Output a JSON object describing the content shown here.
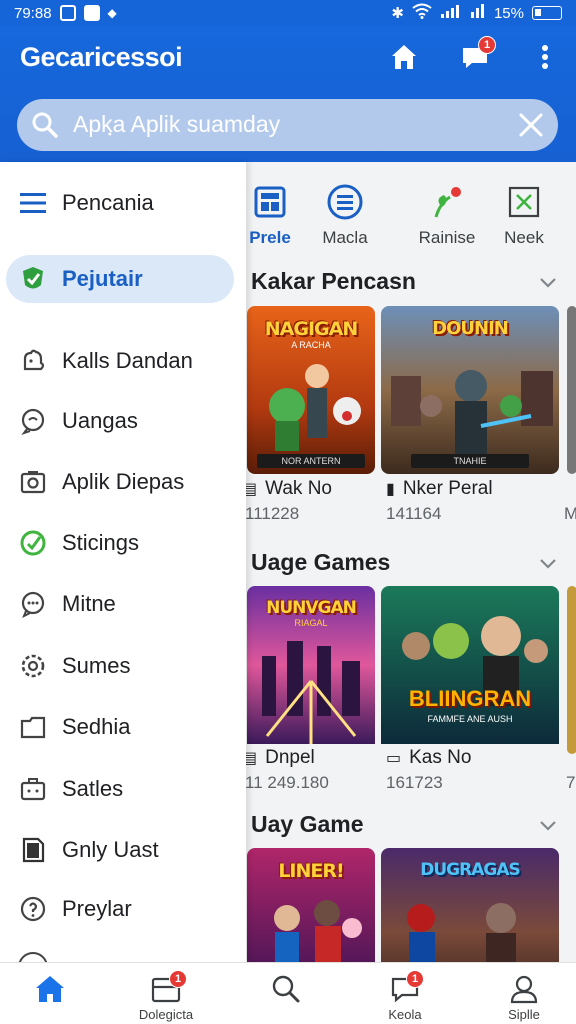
{
  "status_bar": {
    "time": "79:88",
    "battery": "15%"
  },
  "app": {
    "title": "Gecaricessoi",
    "notification_count": "1"
  },
  "search": {
    "text": "Apkฺa Aplik suamday"
  },
  "drawer": {
    "items": [
      {
        "label": "Pencania",
        "icon": "menu-icon"
      },
      {
        "label": "Pejutair",
        "icon": "check-shield-icon",
        "active": true
      },
      {
        "label": "Kalls Dandan",
        "icon": "puzzle-icon"
      },
      {
        "label": "Uangas",
        "icon": "chat-icon"
      },
      {
        "label": "Aplik Diepas",
        "icon": "camera-icon"
      },
      {
        "label": "Sticings",
        "icon": "green-circle-icon"
      },
      {
        "label": "Mitne",
        "icon": "message-icon"
      },
      {
        "label": "Sumes",
        "icon": "gear-icon"
      },
      {
        "label": "Sedhia",
        "icon": "folder-icon"
      },
      {
        "label": "Satles",
        "icon": "briefcase-icon"
      },
      {
        "label": "Gnly Uast",
        "icon": "document-icon"
      },
      {
        "label": "Preylar",
        "icon": "info-circle-icon"
      }
    ]
  },
  "tabs": [
    {
      "label": "Prele",
      "icon": "grid-icon",
      "active": true
    },
    {
      "label": "Macla",
      "icon": "list-circle-icon"
    },
    {
      "label": "Rainise",
      "icon": "sprout-icon"
    },
    {
      "label": "Neek",
      "icon": "x-box-icon"
    }
  ],
  "sections": [
    {
      "title": "Kakar Pencasn",
      "games": [
        {
          "art_title": "NAGIGAN",
          "art_sub": "A RACHA",
          "banner": "NOR ANTERN",
          "label": "Wak No",
          "count": "111228"
        },
        {
          "art_title": "DOUNIN",
          "art_sub": "",
          "banner": "TNAHIE",
          "label": "Nker Peral",
          "count": "141164"
        },
        {
          "label": "",
          "count": "M"
        }
      ]
    },
    {
      "title": "Uage Games",
      "games": [
        {
          "art_title": "NUNVGAN",
          "art_sub": "RIAGAL",
          "banner": "",
          "label": "Dnpel",
          "count": "11 249.180"
        },
        {
          "art_title": "BLIINGRAN",
          "art_sub": "FAMMFE ANE AUSH",
          "banner": "",
          "label": "Kas No",
          "count": "161723"
        },
        {
          "label": "",
          "count": "7"
        }
      ]
    },
    {
      "title": "Uay Game",
      "games": [
        {
          "art_title": "LINER!",
          "art_sub": ""
        },
        {
          "art_title": "DUGRAGAS",
          "art_sub": ""
        }
      ]
    }
  ],
  "bottom_nav": [
    {
      "label": "",
      "icon": "home-icon",
      "active": true
    },
    {
      "label": "Dolegicta",
      "icon": "inbox-icon",
      "badge": "1"
    },
    {
      "label": "",
      "icon": "search-icon"
    },
    {
      "label": "Keola",
      "icon": "chat-bubble-icon",
      "badge": "1"
    },
    {
      "label": "Siplle",
      "icon": "profile-icon"
    }
  ],
  "colors": {
    "primary": "#1565d8",
    "accent_green": "#3fb53f",
    "badge_red": "#e53935"
  }
}
